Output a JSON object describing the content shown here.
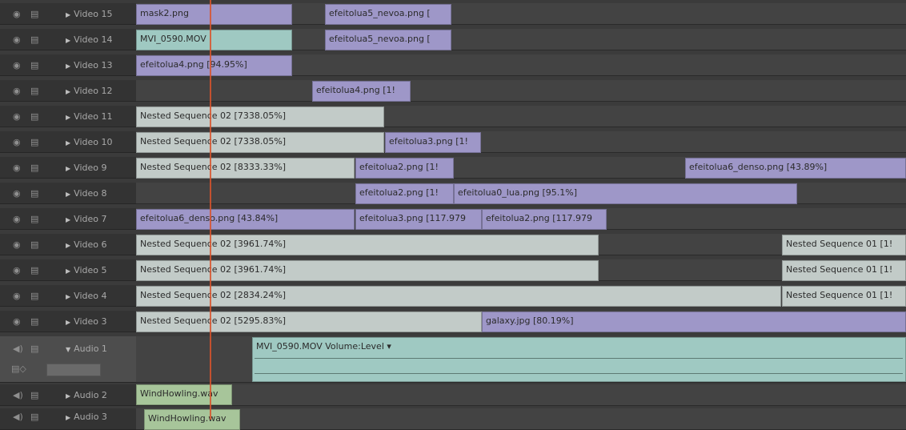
{
  "tracks": [
    {
      "name": "Video 15"
    },
    {
      "name": "Video 14"
    },
    {
      "name": "Video 13"
    },
    {
      "name": "Video 12"
    },
    {
      "name": "Video 11"
    },
    {
      "name": "Video 10"
    },
    {
      "name": "Video 9"
    },
    {
      "name": "Video 8"
    },
    {
      "name": "Video 7"
    },
    {
      "name": "Video 6"
    },
    {
      "name": "Video 5"
    },
    {
      "name": "Video 4"
    },
    {
      "name": "Video 3"
    },
    {
      "name": "Audio 1"
    },
    {
      "name": "Audio 2"
    },
    {
      "name": "Audio 3"
    }
  ],
  "clips": {
    "v15a": "mask2.png",
    "v15b": "efeitolua5_nevoa.png [",
    "v14a": "MVI_0590.MOV",
    "v14b": "efeitolua5_nevoa.png [",
    "v13a": "efeitolua4.png [94.95%]",
    "v12a": "efeitolua4.png [1!",
    "v11a": "Nested Sequence 02 [7338.05%]",
    "v10a": "Nested Sequence 02 [7338.05%]",
    "v10b": "efeitolua3.png [1!",
    "v9a": "Nested Sequence 02 [8333.33%]",
    "v9b": "efeitolua2.png [1!",
    "v9c": "efeitolua6_denso.png [43.89%]",
    "v8a": "efeitolua2.png [1!",
    "v8b": "efeitolua0_lua.png [95.1%]",
    "v7a": "efeitolua6_denso.png [43.84%]",
    "v7b": "efeitolua3.png [117.979",
    "v7c": "efeitolua2.png [117.979",
    "v6a": "Nested Sequence 02 [3961.74%]",
    "v6b": "Nested Sequence 01 [1!",
    "v5a": "Nested Sequence 02 [3961.74%]",
    "v5b": "Nested Sequence 01 [1!",
    "v4a": "Nested Sequence 02 [2834.24%]",
    "v4b": "Nested Sequence 01 [1!",
    "v3a": "Nested Sequence 02 [5295.83%]",
    "v3b": "galaxy.jpg [80.19%]",
    "a1a": "MVI_0590.MOV  Volume:Level ▾",
    "a2a": "WindHowling.wav",
    "a3a": "WindHowling.wav"
  }
}
